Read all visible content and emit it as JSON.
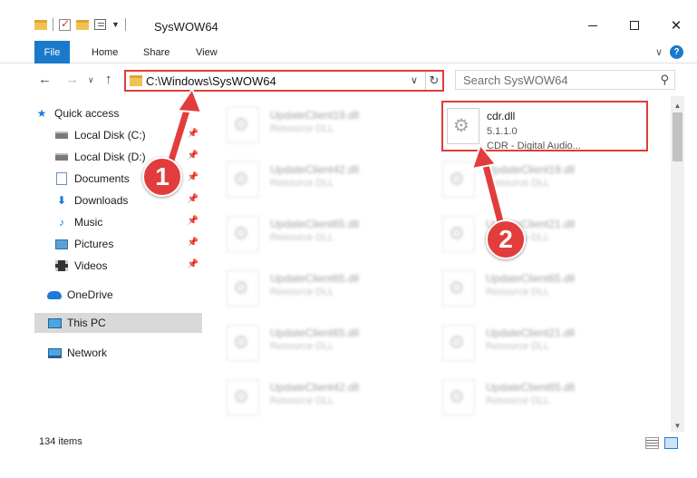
{
  "window": {
    "title": "SysWOW64"
  },
  "ribbon": {
    "file_label": "File",
    "tabs": [
      {
        "label": "Home"
      },
      {
        "label": "Share"
      },
      {
        "label": "View"
      }
    ]
  },
  "nav": {
    "address_path": "C:\\Windows\\SysWOW64",
    "search_placeholder": "Search SysWOW64"
  },
  "sidebar": {
    "items": [
      {
        "label": "Quick access",
        "icon": "star-icon"
      },
      {
        "label": "Local Disk (C:)",
        "icon": "drive-icon",
        "pinned": true
      },
      {
        "label": "Local Disk (D:)",
        "icon": "drive-icon",
        "pinned": true
      },
      {
        "label": "Documents",
        "icon": "documents-icon",
        "pinned": true
      },
      {
        "label": "Downloads",
        "icon": "downloads-icon",
        "pinned": true
      },
      {
        "label": "Music",
        "icon": "music-icon",
        "pinned": true
      },
      {
        "label": "Pictures",
        "icon": "pictures-icon",
        "pinned": true
      },
      {
        "label": "Videos",
        "icon": "videos-icon",
        "pinned": true
      },
      {
        "label": "OneDrive",
        "icon": "onedrive-icon"
      },
      {
        "label": "This PC",
        "icon": "this-pc-icon",
        "selected": true
      },
      {
        "label": "Network",
        "icon": "network-icon"
      }
    ]
  },
  "files": {
    "highlighted": {
      "name": "cdr.dll",
      "version": "5.1.1.0",
      "description": "CDR - Digital Audio..."
    },
    "left_column": [
      {
        "name": "UpdateClient19.dll",
        "description": "Resource DLL"
      },
      {
        "name": "UpdateClient42.dll",
        "description": "Resource DLL"
      },
      {
        "name": "UpdateClient65.dll",
        "description": "Resource DLL"
      },
      {
        "name": "UpdateClient65.dll",
        "description": "Resource DLL"
      },
      {
        "name": "UpdateClient65.dll",
        "description": "Resource DLL"
      },
      {
        "name": "UpdateClient42.dll",
        "description": "Resource DLL"
      }
    ],
    "right_column": [
      {
        "name": "UpdateClient19.dll",
        "description": "Resource DLL"
      },
      {
        "name": "UpdateClient21.dll",
        "description": "Resource DLL"
      },
      {
        "name": "UpdateClient65.dll",
        "description": "Resource DLL"
      },
      {
        "name": "UpdateClient21.dll",
        "description": "Resource DLL"
      },
      {
        "name": "UpdateClient65.dll",
        "description": "Resource DLL"
      }
    ]
  },
  "status": {
    "item_count": "134 items"
  },
  "callouts": {
    "step1": "1",
    "step2": "2",
    "color": "#e23c3c"
  },
  "colors": {
    "accent": "#1979ca",
    "highlight_border": "#e13b3b"
  }
}
